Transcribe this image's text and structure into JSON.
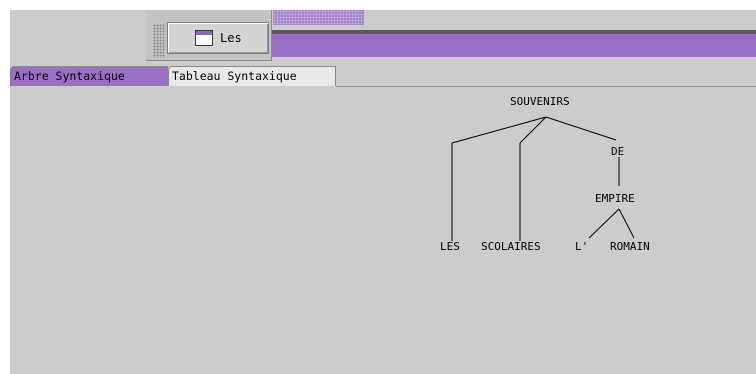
{
  "toolbar": {
    "window_button_label": "Les",
    "window_button_icon": "window-icon"
  },
  "tabs": [
    {
      "label": "Arbre Syntaxique",
      "active": true
    },
    {
      "label": "Tableau Syntaxique",
      "active": false
    }
  ],
  "tree": {
    "root": "SOUVENIRS",
    "nodes": {
      "de": "DE",
      "empire": "EMPIRE",
      "les": "LES",
      "scolaires": "SCOLAIRES",
      "l": "L'",
      "romain": "ROMAIN"
    }
  },
  "colors": {
    "accent": "#9b6fc6",
    "panel": "#cccccc"
  }
}
